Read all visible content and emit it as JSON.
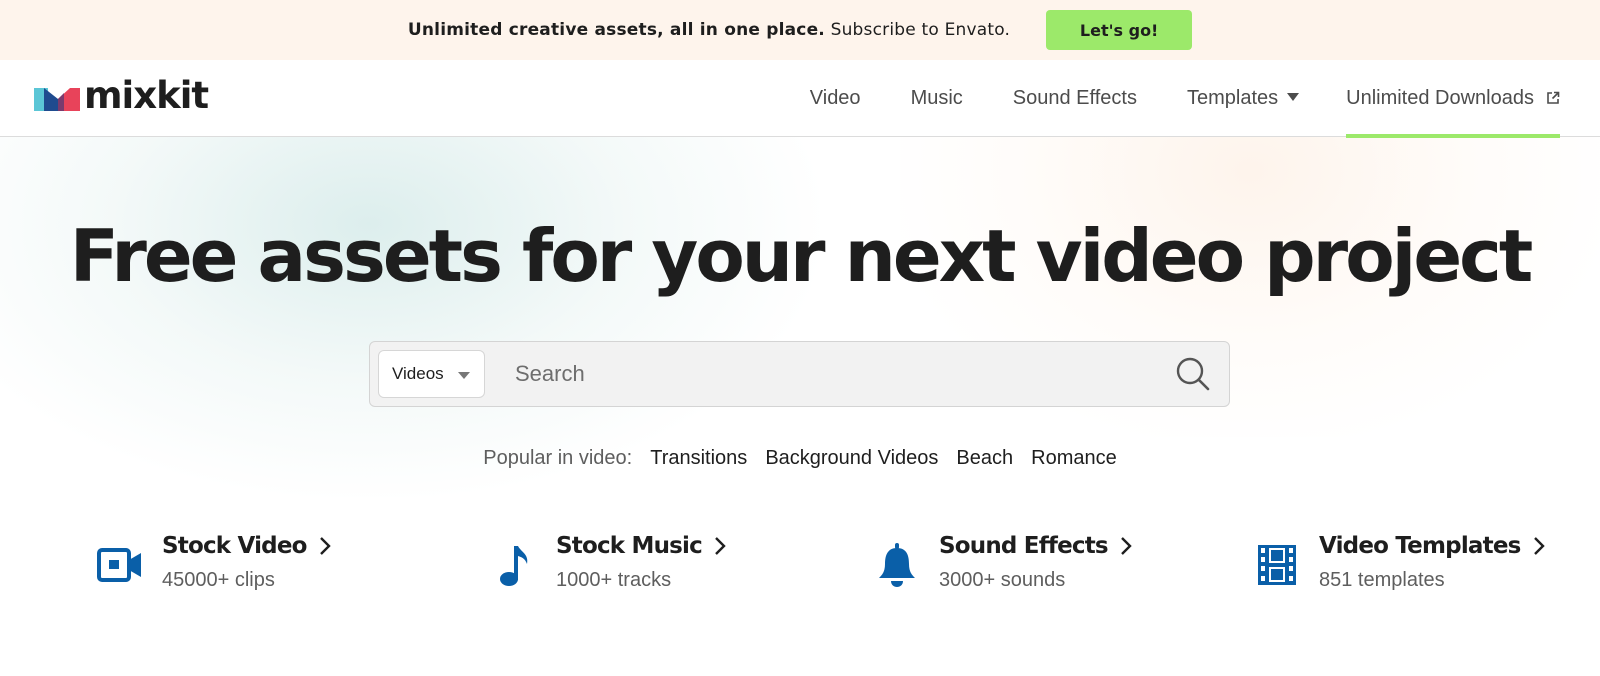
{
  "promo": {
    "text_bold": "Unlimited creative assets, all in one place.",
    "text_rest": "Subscribe to Envato.",
    "button_label": "Let's go!"
  },
  "header": {
    "logo_text": "mixkit",
    "nav": [
      {
        "label": "Video"
      },
      {
        "label": "Music"
      },
      {
        "label": "Sound Effects"
      },
      {
        "label": "Templates",
        "has_dropdown": true
      },
      {
        "label": "Unlimited Downloads",
        "external": true,
        "active": true
      }
    ]
  },
  "hero": {
    "title": "Free assets for your next video project",
    "search": {
      "category": "Videos",
      "placeholder": "Search"
    },
    "popular": {
      "label": "Popular in video:",
      "links": [
        "Transitions",
        "Background Videos",
        "Beach",
        "Romance"
      ]
    }
  },
  "categories": [
    {
      "title": "Stock Video",
      "subtitle": "45000+ clips",
      "icon": "video-camera-icon"
    },
    {
      "title": "Stock Music",
      "subtitle": "1000+ tracks",
      "icon": "music-note-icon"
    },
    {
      "title": "Sound Effects",
      "subtitle": "3000+ sounds",
      "icon": "bell-icon"
    },
    {
      "title": "Video Templates",
      "subtitle": "851 templates",
      "icon": "film-strip-icon"
    }
  ],
  "colors": {
    "accent_green": "#9ce96a",
    "promo_bg": "#fef4ec",
    "icon_blue": "#0a5fa8",
    "text_dark": "#1e1e1e"
  }
}
